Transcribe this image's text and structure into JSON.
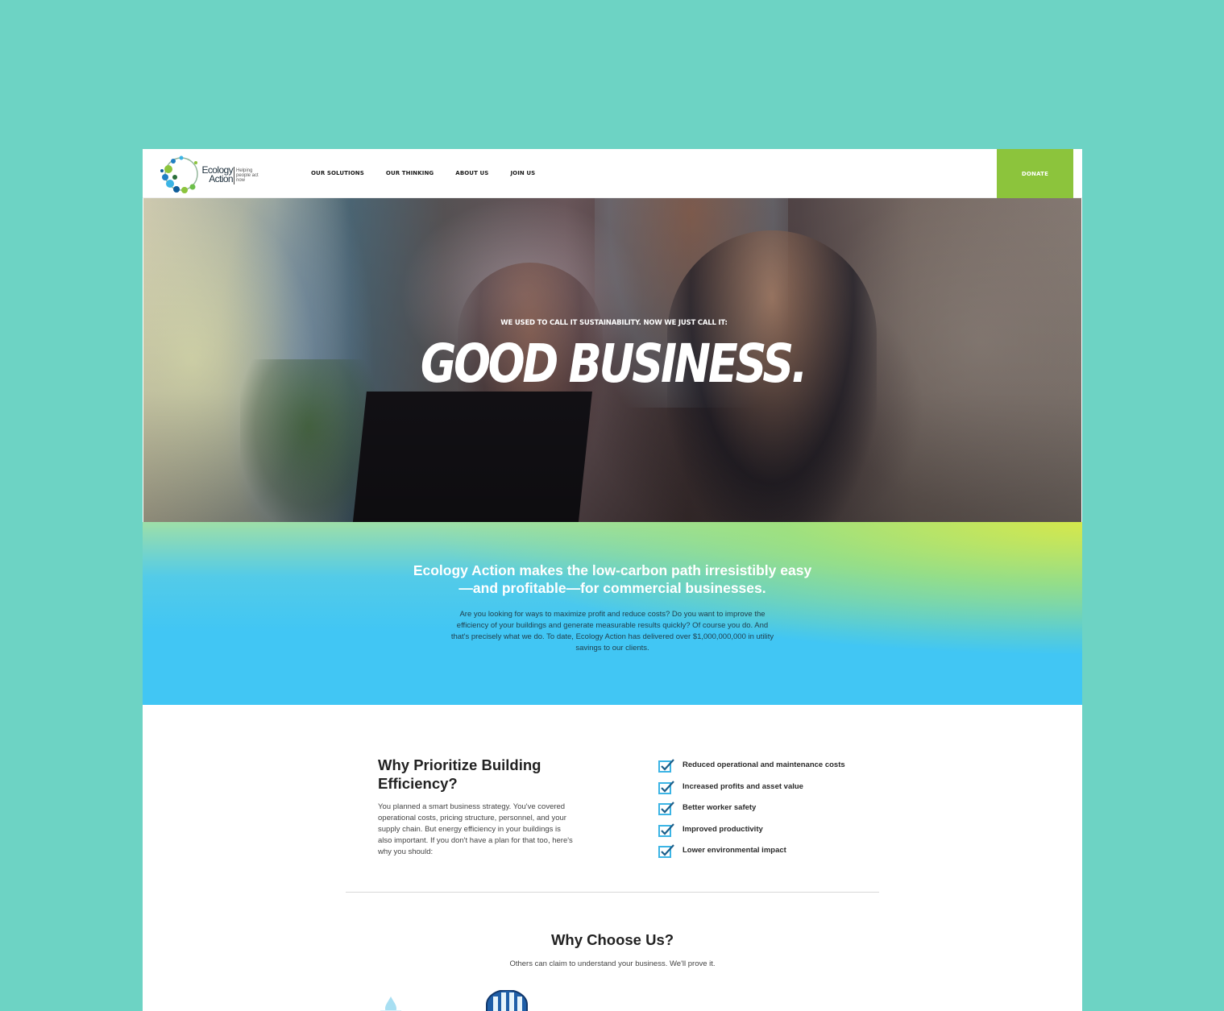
{
  "header": {
    "logo": {
      "name": "Ecology Action",
      "tagline": "Helping people act now"
    },
    "nav": [
      "OUR SOLUTIONS",
      "OUR THINKING",
      "ABOUT US",
      "JOIN US"
    ],
    "donate_label": "DONATE"
  },
  "hero": {
    "eyebrow": "WE USED TO CALL IT SUSTAINABILITY. NOW WE JUST CALL IT:",
    "title": "GOOD BUSINESS."
  },
  "intro": {
    "title": "Ecology Action makes the low-carbon path irresistibly easy—and profitable—for commercial businesses.",
    "body": "Are you looking for ways to maximize profit and reduce costs? Do you want to improve the efficiency of your buildings and generate measurable results quickly? Of course you do. And that's precisely what we do. To date, Ecology Action has delivered over $1,000,000,000 in utility savings to our clients."
  },
  "why": {
    "title": "Why Prioritize Building Efficiency?",
    "body": "You planned a smart business strategy. You've covered operational costs, pricing structure, personnel, and your supply chain. But energy efficiency in your buildings is also important. If you don't have a plan for that too, here's why you should:",
    "benefits": [
      "Reduced operational and maintenance costs",
      "Increased profits and asset value",
      "Better worker safety",
      "Improved productivity",
      "Lower environmental impact"
    ]
  },
  "choose": {
    "title": "Why Choose Us?",
    "subtitle": "Others can claim to understand your business. We'll prove it."
  },
  "colors": {
    "background": "#6dd3c4",
    "donate": "#8cc43c",
    "intro_blue": "#41c6f4",
    "intro_green": "#d6e84b",
    "check_blue": "#3bb4e5"
  },
  "icons": [
    "logo-circle-icon",
    "checkbox-check-icon",
    "water-drop-icon",
    "building-icon"
  ]
}
